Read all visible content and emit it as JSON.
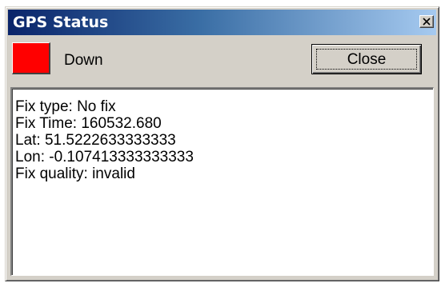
{
  "window": {
    "title": "GPS Status"
  },
  "status": {
    "color": "#ff0000",
    "label": "Down"
  },
  "buttons": {
    "close_label": "Close"
  },
  "info": {
    "lines": [
      "Fix type: No fix",
      "Fix Time: 160532.680",
      "Lat: 51.5222633333333",
      "Lon: -0.107413333333333",
      "Fix quality: invalid"
    ]
  }
}
